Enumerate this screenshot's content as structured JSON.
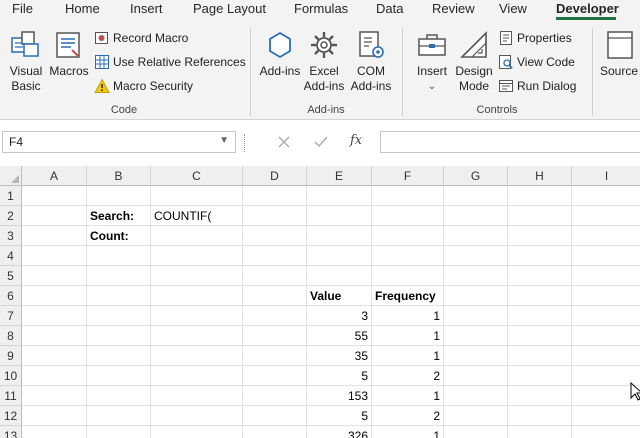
{
  "tabs": [
    {
      "label": "File",
      "active": false
    },
    {
      "label": "Home",
      "active": false
    },
    {
      "label": "Insert",
      "active": false
    },
    {
      "label": "Page Layout",
      "active": false
    },
    {
      "label": "Formulas",
      "active": false
    },
    {
      "label": "Data",
      "active": false
    },
    {
      "label": "Review",
      "active": false
    },
    {
      "label": "View",
      "active": false
    },
    {
      "label": "Developer",
      "active": true
    }
  ],
  "ribbon": {
    "code": {
      "label": "Code",
      "visual_basic": "Visual Basic",
      "macros": "Macros",
      "record_macro": "Record Macro",
      "relative_refs": "Use Relative References",
      "macro_security": "Macro Security"
    },
    "addins": {
      "label": "Add-ins",
      "addins": "Add-ins",
      "excel_addins": "Excel Add-ins",
      "com_addins": "COM Add-ins"
    },
    "controls": {
      "label": "Controls",
      "insert": "Insert",
      "design_mode": "Design Mode",
      "properties": "Properties",
      "view_code": "View Code",
      "run_dialog": "Run Dialog"
    },
    "xml": {
      "source": "Source"
    }
  },
  "formula_bar": {
    "name_box": "F4",
    "cancel_icon": "x-icon",
    "enter_icon": "check-icon",
    "fx_label": "fx",
    "formula": ""
  },
  "grid": {
    "columns": [
      "A",
      "B",
      "C",
      "D",
      "E",
      "F",
      "G",
      "H",
      "I"
    ],
    "rows": [
      "1",
      "2",
      "3",
      "4",
      "5",
      "6",
      "7",
      "8",
      "9",
      "10",
      "11",
      "12",
      "13"
    ],
    "cells": {
      "B2": "Search:",
      "C2": "COUNTIF(",
      "B3": "Count:",
      "E6": "Value",
      "F6": "Frequency",
      "E7": "3",
      "F7": "1",
      "E8": "55",
      "F8": "1",
      "E9": "35",
      "F9": "1",
      "E10": "5",
      "F10": "2",
      "E11": "153",
      "F11": "1",
      "E12": "5",
      "F12": "2",
      "E13": "326",
      "F13": "1"
    }
  },
  "colors": {
    "accent": "#217346",
    "ribbon_bg": "#f3f3f3",
    "header_bg": "#efefef",
    "icon_blue": "#2b6cb5"
  }
}
